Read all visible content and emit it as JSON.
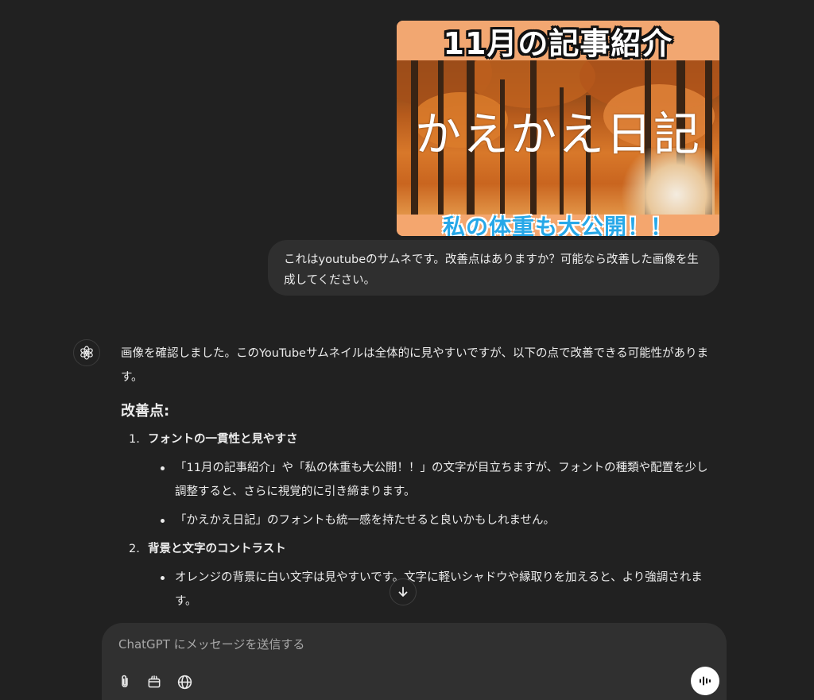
{
  "thumbnail": {
    "title_top": "11月の記事紹介",
    "title_main": "かえかえ日記",
    "title_bottom": "私の体重も大公開！！"
  },
  "user_message": "これはyoutubeのサムネです。改善点はありますか？可能なら改善した画像を生成してください。",
  "assistant": {
    "avatar_icon": "openai-logo-icon",
    "intro": "画像を確認しました。このYouTubeサムネイルは全体的に見やすいですが、以下の点で改善できる可能性があります。",
    "heading": "改善点:",
    "sections": [
      {
        "number": "1.",
        "title": "フォントの一貫性と見やすさ",
        "bullets": [
          "「11月の記事紹介」や「私の体重も大公開！！」の文字が目立ちますが、フォントの種類や配置を少し調整すると、さらに視覚的に引き締まります。",
          "「かえかえ日記」のフォントも統一感を持たせると良いかもしれません。"
        ]
      },
      {
        "number": "2.",
        "title": "背景と文字のコントラスト",
        "bullets": [
          "オレンジの背景に白い文字は見やすいです。文字に軽いシャドウや縁取りを加えると、より強調されます。"
        ]
      }
    ]
  },
  "composer": {
    "placeholder": "ChatGPT にメッセージを送信する",
    "icons": [
      "paperclip-icon",
      "toolbox-icon",
      "globe-icon",
      "voice-mode-icon"
    ]
  },
  "colors": {
    "background": "#212121",
    "bubble": "#2f2f2f",
    "composer": "#303030",
    "text": "#ececec"
  }
}
